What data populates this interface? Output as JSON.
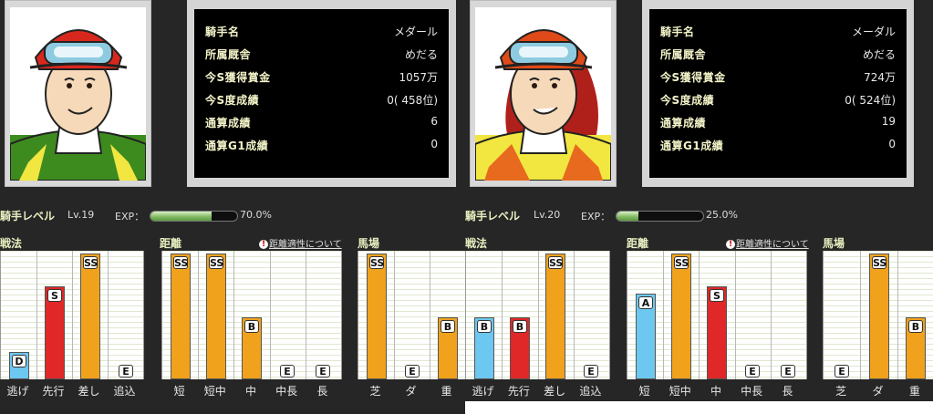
{
  "jockeys": [
    {
      "portrait": {
        "icon": "jockey-portrait-male",
        "helmet_color": "#d8281e",
        "silks_color": "#3d8b1f"
      },
      "info": [
        {
          "key": "騎手名",
          "value": "メダール"
        },
        {
          "key": "所属厩舎",
          "value": "めだる"
        },
        {
          "key": "今S獲得賞金",
          "value": "1057万"
        },
        {
          "key": "今S度成績",
          "value": "0( 458位)"
        },
        {
          "key": "通算成績",
          "value": "6"
        },
        {
          "key": "通算G1成績",
          "value": "0"
        }
      ],
      "level": {
        "label": "騎手レベル",
        "value": "Lv.19",
        "exp_label": "EXP：",
        "exp_fraction": 0.7,
        "exp_text": "70.0%"
      },
      "sections": [
        {
          "title": "戦法",
          "categories": [
            "逃げ",
            "先行",
            "差し",
            "追込"
          ],
          "grades": [
            "D",
            "S",
            "SS",
            "E"
          ]
        },
        {
          "title": "距離",
          "link": "距離適性について",
          "categories": [
            "短",
            "短中",
            "中",
            "中長",
            "長"
          ],
          "grades": [
            "SS",
            "SS",
            "B",
            "E",
            "E"
          ]
        },
        {
          "title": "馬場",
          "categories": [
            "芝",
            "ダ",
            "重"
          ],
          "grades": [
            "SS",
            "E",
            "B"
          ]
        }
      ]
    },
    {
      "portrait": {
        "icon": "jockey-portrait-female",
        "helmet_color": "#e04a18",
        "silks_color": "#f2e640"
      },
      "info": [
        {
          "key": "騎手名",
          "value": "メーダル"
        },
        {
          "key": "所属厩舎",
          "value": "めだる"
        },
        {
          "key": "今S獲得賞金",
          "value": "724万"
        },
        {
          "key": "今S度成績",
          "value": "0( 524位)"
        },
        {
          "key": "通算成績",
          "value": "19"
        },
        {
          "key": "通算G1成績",
          "value": "0"
        }
      ],
      "level": {
        "label": "騎手レベル",
        "value": "Lv.20",
        "exp_label": "EXP：",
        "exp_fraction": 0.25,
        "exp_text": "25.0%"
      },
      "sections": [
        {
          "title": "戦法",
          "categories": [
            "逃げ",
            "先行",
            "差し",
            "追込"
          ],
          "grades": [
            "B",
            "B",
            "SS",
            "E"
          ]
        },
        {
          "title": "距離",
          "link": "距離適性について",
          "categories": [
            "短",
            "短中",
            "中",
            "中長",
            "長"
          ],
          "grades": [
            "A",
            "SS",
            "S",
            "E",
            "E"
          ]
        },
        {
          "title": "馬場",
          "categories": [
            "芝",
            "ダ",
            "重"
          ],
          "grades": [
            "E",
            "SS",
            "B"
          ]
        }
      ]
    }
  ],
  "grade_scale": {
    "SS": 1.0,
    "S": 0.74,
    "A": 0.68,
    "B": 0.49,
    "C": 0.38,
    "D": 0.22,
    "E": 0.0
  },
  "grade_colors": {
    "SS": "#f0a21c",
    "S": "#e02828",
    "A": "#6cc8f0",
    "B": "#f0a21c",
    "D": "#6cc8f0",
    "E": "#ffffff",
    "B_alt_blue": "#6cc8f0",
    "B_alt_red": "#e02828"
  }
}
